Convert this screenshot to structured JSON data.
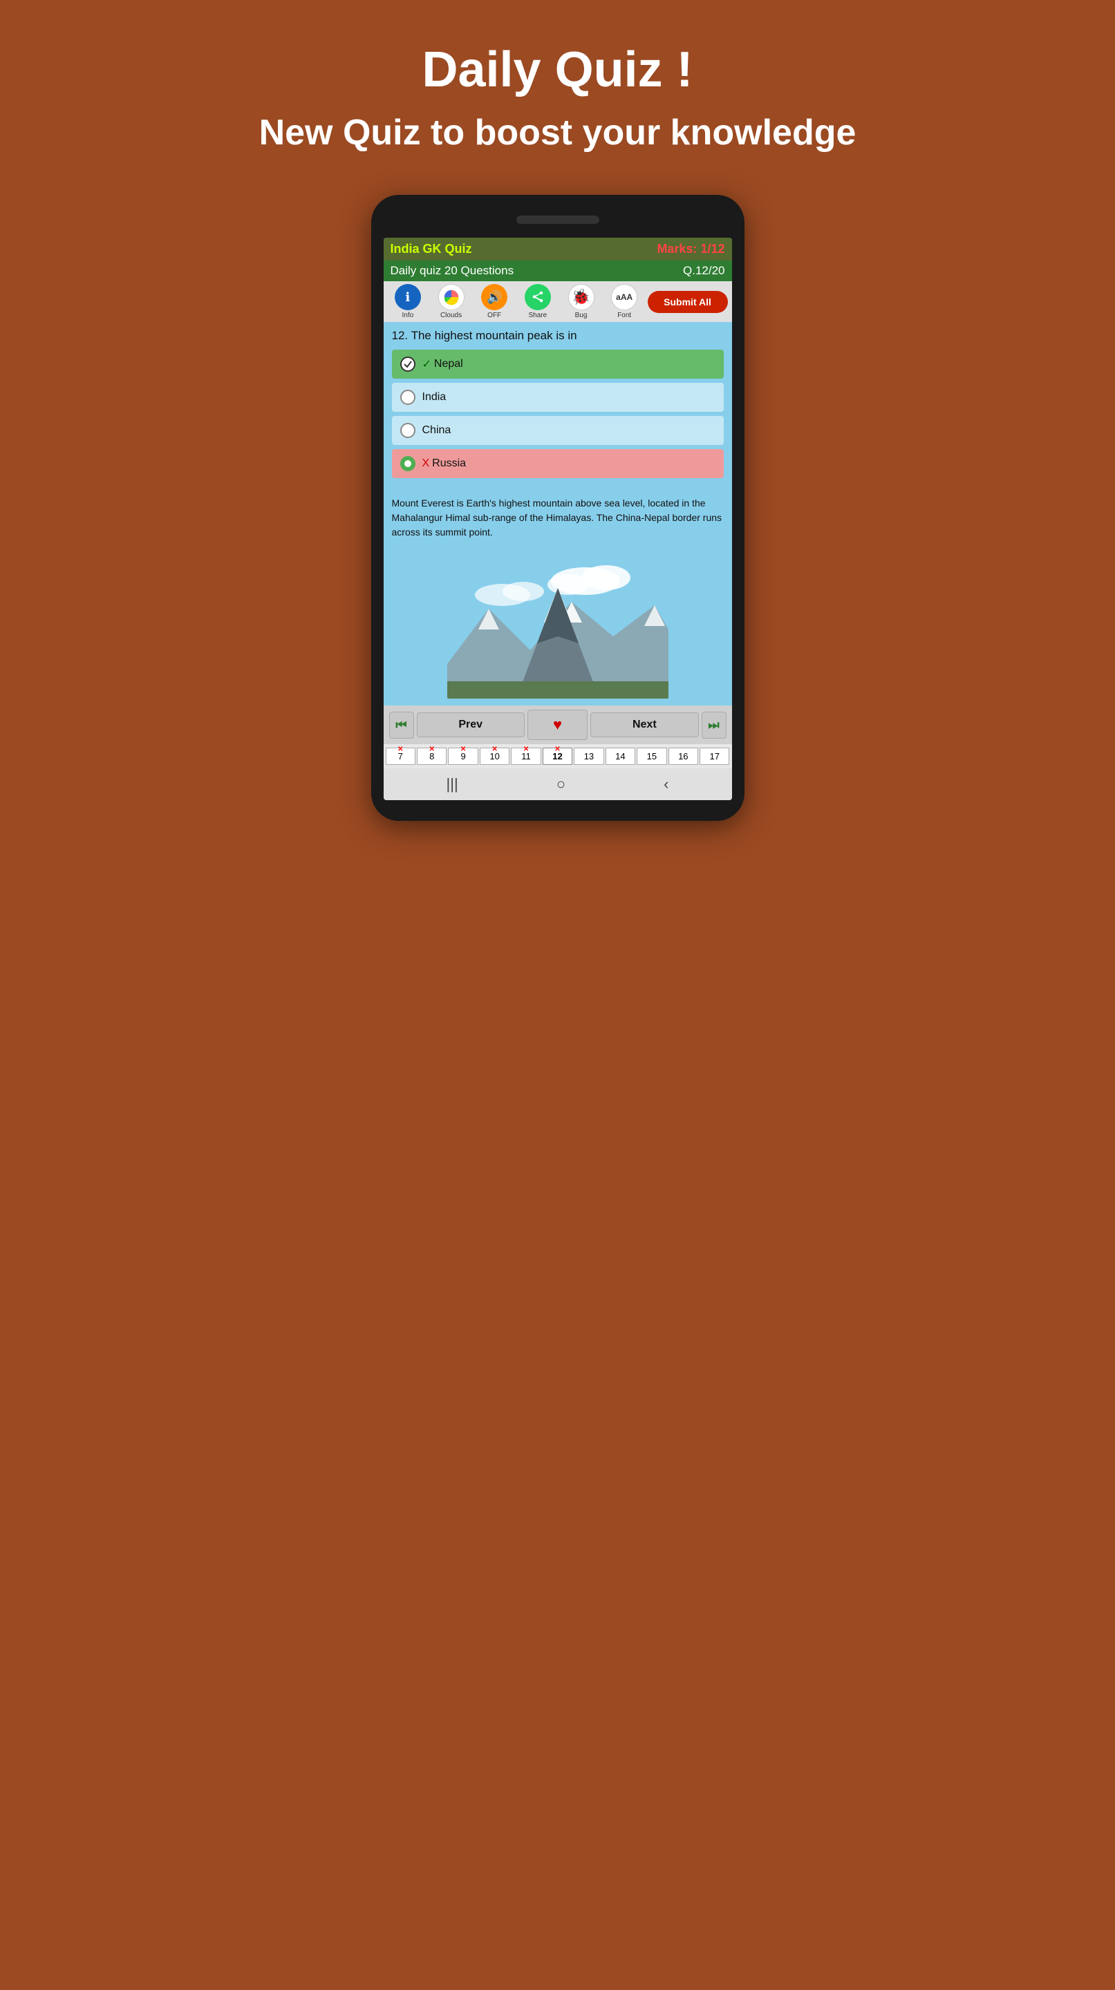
{
  "page": {
    "title": "Daily Quiz !",
    "subtitle": "New Quiz to boost your knowledge"
  },
  "quiz": {
    "title": "India GK Quiz",
    "marks": "Marks: 1/12",
    "daily_quiz_label": "Daily quiz  20 Questions",
    "q_number": "Q.12/20",
    "question_number": "12.",
    "question_text": "The highest mountain peak is in"
  },
  "toolbar": {
    "info_label": "Info",
    "clouds_label": "Clouds",
    "off_label": "OFF",
    "share_label": "Share",
    "bug_label": "Bug",
    "font_label": "Font",
    "submit_label": "Submit All"
  },
  "options": [
    {
      "text": "Nepal",
      "status": "correct",
      "prefix": "✓"
    },
    {
      "text": "India",
      "status": "normal",
      "prefix": ""
    },
    {
      "text": "China",
      "status": "normal",
      "prefix": ""
    },
    {
      "text": "Russia",
      "status": "wrong",
      "prefix": "X"
    }
  ],
  "explanation": "Mount Everest is Earth's highest mountain above sea level, located in the Mahalangur Himal sub-range of the Himalayas. The China-Nepal border runs across its summit point.",
  "navigation": {
    "prev_label": "Prev",
    "next_label": "Next"
  },
  "q_strip": {
    "numbers": [
      "7",
      "8",
      "9",
      "10",
      "11",
      "12",
      "13",
      "14",
      "15",
      "16",
      "17"
    ],
    "has_cross": [
      true,
      true,
      true,
      true,
      true,
      true,
      false,
      false,
      false,
      false,
      false
    ],
    "current_index": 5
  }
}
